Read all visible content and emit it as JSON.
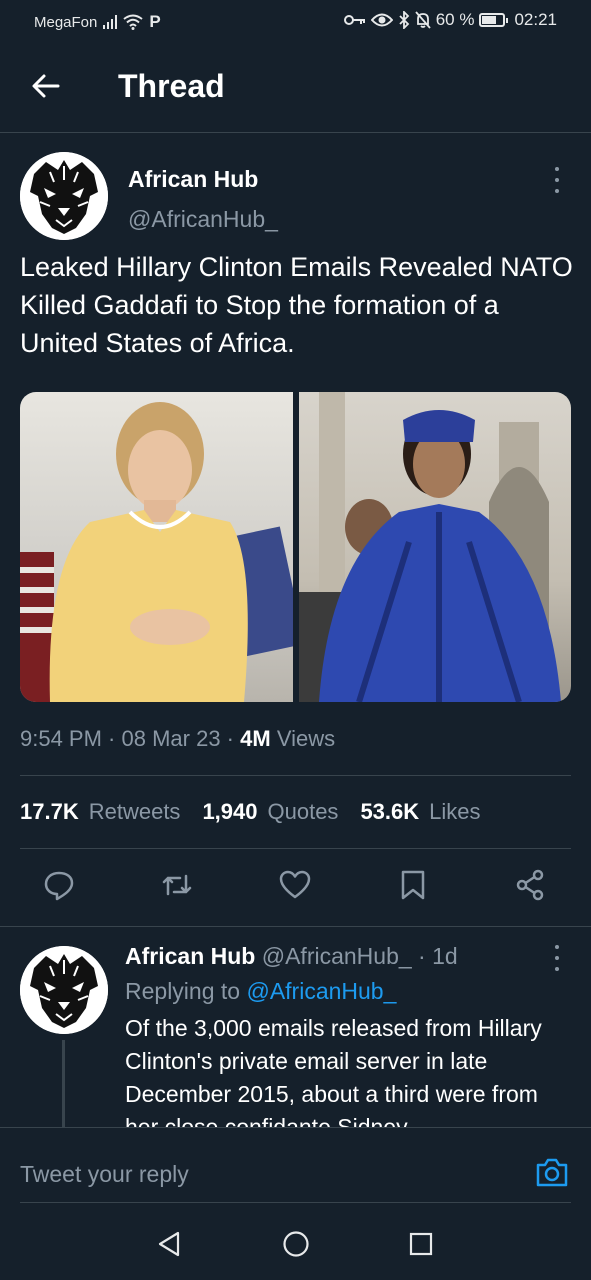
{
  "status_bar": {
    "carrier": "MegaFon",
    "data_icon": "P",
    "battery": "60 %",
    "time": "02:21"
  },
  "header": {
    "title": "Thread"
  },
  "tweet": {
    "author_name": "African Hub",
    "author_handle": "@AfricanHub_",
    "text": "Leaked Hillary Clinton Emails Revealed NATO Killed Gaddafi to Stop the formation of a United States of Africa.",
    "time": "9:54 PM",
    "date": "08 Mar 23",
    "views_count": "4M",
    "views_label": "Views",
    "retweets_count": "17.7K",
    "retweets_label": "Retweets",
    "quotes_count": "1,940",
    "quotes_label": "Quotes",
    "likes_count": "53.6K",
    "likes_label": "Likes"
  },
  "reply": {
    "author_name": "African Hub",
    "author_handle": "@AfricanHub_",
    "age": "1d",
    "replying_prefix": "Replying to",
    "replying_handle": "@AfricanHub_",
    "text": "Of the 3,000 emails released from Hillary Clinton's private email server in late December 2015, about a third were from her close confidante Sidney"
  },
  "composer": {
    "placeholder": "Tweet your reply"
  },
  "colors": {
    "background": "#15202b",
    "accent": "#1d9bf0",
    "secondary_text": "#8b98a5",
    "divider": "#38444d"
  },
  "icons": [
    "back-arrow-icon",
    "more-icon",
    "reply-icon",
    "retweet-icon",
    "like-icon",
    "bookmark-icon",
    "share-icon",
    "camera-icon",
    "nav-back-icon",
    "nav-home-icon",
    "nav-recents-icon"
  ]
}
